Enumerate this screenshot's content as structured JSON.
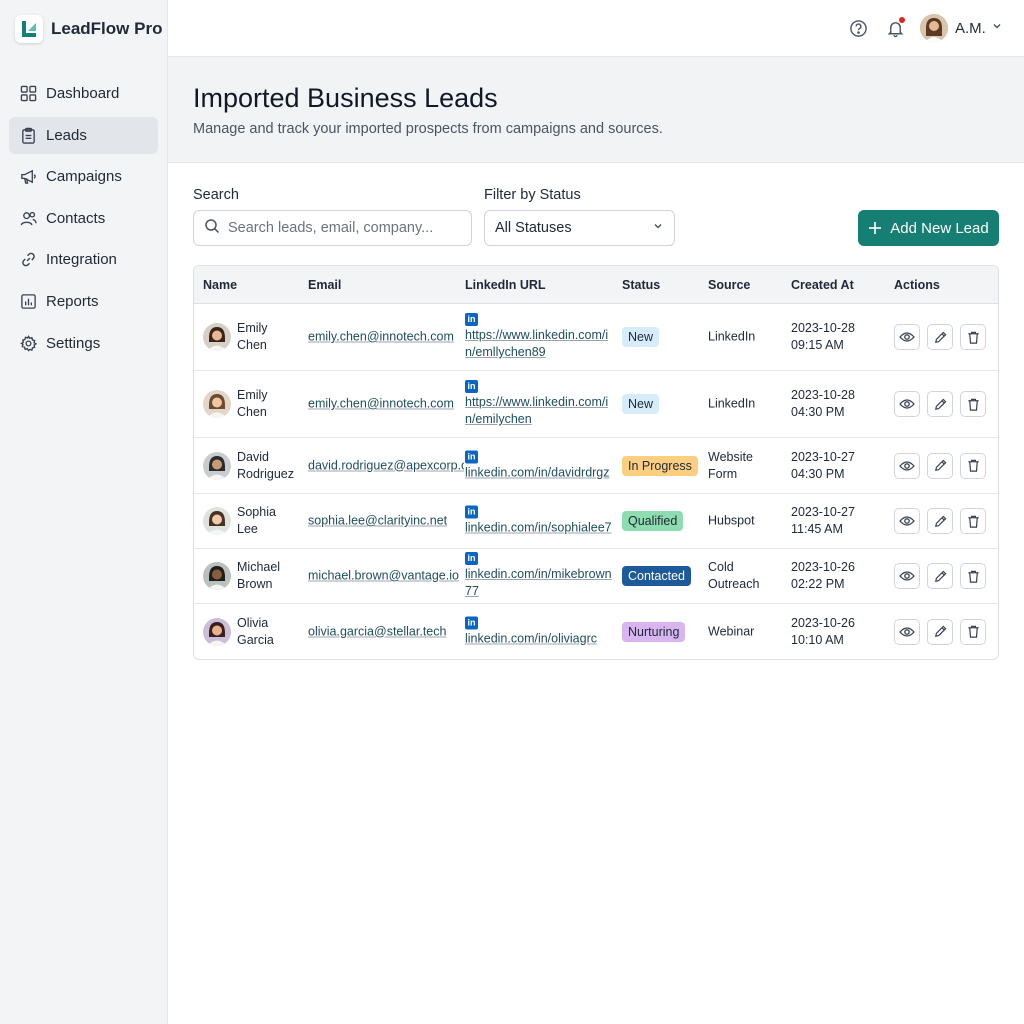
{
  "app": {
    "name": "LeadFlow Pro"
  },
  "sidebar": {
    "items": [
      {
        "label": "Dashboard",
        "icon": "grid-icon"
      },
      {
        "label": "Leads",
        "icon": "clipboard-icon",
        "active": true
      },
      {
        "label": "Campaigns",
        "icon": "megaphone-icon"
      },
      {
        "label": "Contacts",
        "icon": "users-icon"
      },
      {
        "label": "Integration",
        "icon": "link-icon"
      },
      {
        "label": "Reports",
        "icon": "bar-chart-icon"
      },
      {
        "label": "Settings",
        "icon": "gear-icon"
      }
    ]
  },
  "topbar": {
    "user_name": "A.M."
  },
  "header": {
    "title": "Imported Business Leads",
    "subtitle": "Manage and track your imported prospects from campaigns and sources."
  },
  "filters": {
    "search_label": "Search",
    "search_placeholder": "Search leads, email, company...",
    "status_label": "Filter by Status",
    "status_value": "All Statuses",
    "add_button": "Add New Lead"
  },
  "table": {
    "columns": [
      "Name",
      "Email",
      "LinkedIn URL",
      "Status",
      "Source",
      "Created At",
      "Actions"
    ],
    "rows": [
      {
        "first": "Emily",
        "last": "Chen",
        "email": "emily.chen@innotech.com",
        "linkedin": "https://www.linkedin.com/in/emllychen89",
        "status": "New",
        "source_1": "LinkedIn",
        "source_2": "",
        "date": "2023-10-28",
        "time": "09:15 AM"
      },
      {
        "first": "Emily",
        "last": "Chen",
        "email": "emily.chen@innotech.com",
        "linkedin": "https://www.linkedin.com/in/emilychen",
        "status": "New",
        "source_1": "LinkedIn",
        "source_2": "",
        "date": "2023-10-28",
        "time": "04:30 PM"
      },
      {
        "first": "David",
        "last": "Rodriguez",
        "email": "david.rodriguez@apexcorp.c",
        "linkedin": "linkedin.com/in/davidrdrgz",
        "status": "In Progress",
        "source_1": "Website",
        "source_2": "Form",
        "date": "2023-10-27",
        "time": "04:30 PM"
      },
      {
        "first": "Sophia",
        "last": "Lee",
        "email": "sophia.lee@clarityinc.net",
        "linkedin": "linkedin.com/in/sophialee7",
        "status": "Qualified",
        "source_1": "Hubspot",
        "source_2": "",
        "date": "2023-10-27",
        "time": "11:45 AM"
      },
      {
        "first": "Michael",
        "last": "Brown",
        "email": "michael.brown@vantage.io",
        "linkedin": "linkedin.com/in/mikebrown77",
        "status": "Contacted",
        "source_1": "Cold",
        "source_2": "Outreach",
        "date": "2023-10-26",
        "time": "02:22 PM"
      },
      {
        "first": "Olivia",
        "last": "Garcia",
        "email": "olivia.garcia@stellar.tech",
        "linkedin": "linkedin.com/in/oliviagrc",
        "status": "Nurturing",
        "source_1": "Webinar",
        "source_2": "",
        "date": "2023-10-26",
        "time": "10:10 AM"
      }
    ]
  },
  "status_colors": {
    "New": {
      "bg": "#d6ecfa",
      "fg": "#1f2937"
    },
    "In Progress": {
      "bg": "#fbcf7f",
      "fg": "#1f2937"
    },
    "Qualified": {
      "bg": "#8fdcb0",
      "fg": "#1f2937"
    },
    "Contacted": {
      "bg": "#1d5a9c",
      "fg": "#ffffff"
    },
    "Nurturing": {
      "bg": "#d9b5f0",
      "fg": "#1f2937"
    }
  },
  "colors": {
    "accent": "#177e74",
    "linkedin": "#0a66c2",
    "notification": "#dc2626"
  }
}
